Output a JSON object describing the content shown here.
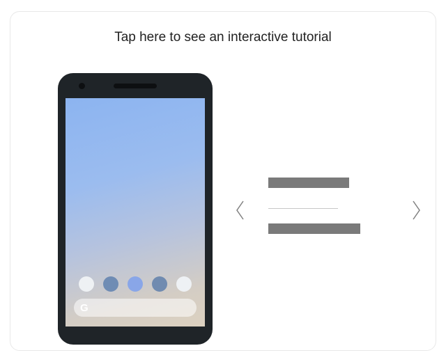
{
  "heading": "Tap here to see an interactive tutorial",
  "search": {
    "letter": "G"
  },
  "icons": {
    "prev": "chevron-left-icon",
    "next": "chevron-right-icon"
  }
}
